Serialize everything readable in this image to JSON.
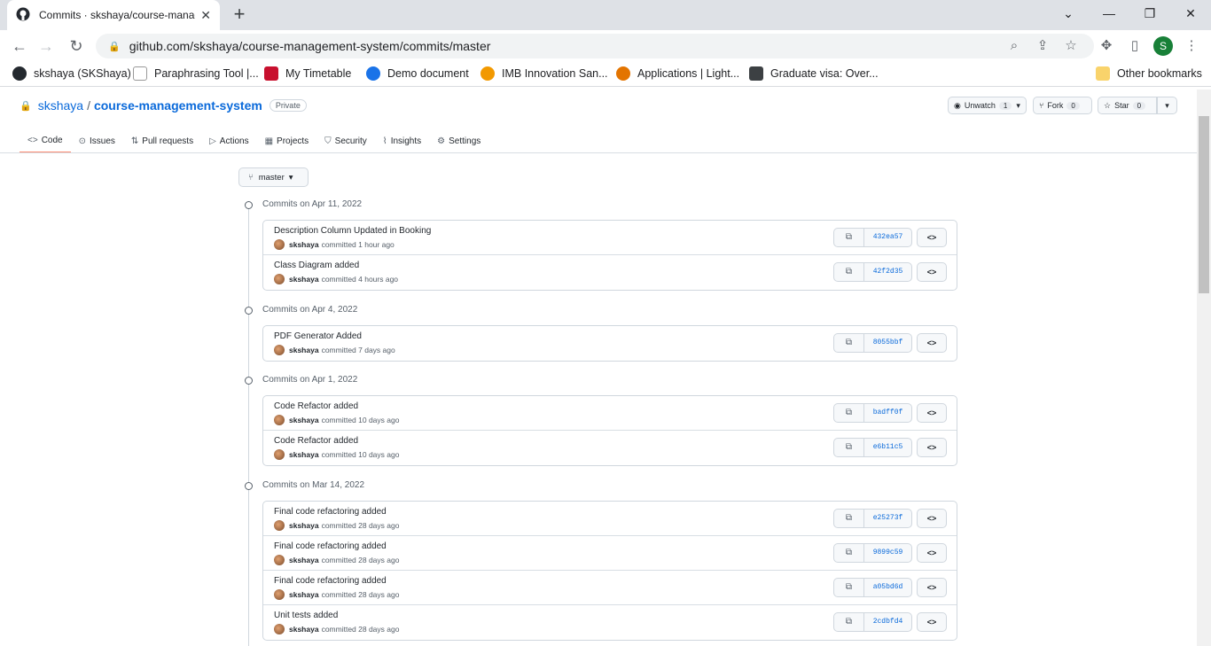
{
  "browser": {
    "tab_title": "Commits · skshaya/course-manag",
    "url": "github.com/skshaya/course-management-system/commits/master",
    "profile_initial": "S",
    "bookmarks": [
      "skshaya (SKShaya)",
      "Paraphrasing Tool |...",
      "My Timetable",
      "Demo document",
      "IMB Innovation San...",
      "Applications | Light...",
      "Graduate visa: Over..."
    ],
    "other_bookmarks": "Other bookmarks"
  },
  "repo": {
    "owner": "skshaya",
    "separator": "/",
    "name": "course-management-system",
    "visibility": "Private",
    "watch_label": "Unwatch",
    "watch_count": "1",
    "fork_label": "Fork",
    "fork_count": "0",
    "star_label": "Star",
    "star_count": "0"
  },
  "nav": {
    "tabs": [
      {
        "label": "Code",
        "icon": "<>"
      },
      {
        "label": "Issues",
        "icon": "⊙"
      },
      {
        "label": "Pull requests",
        "icon": "⇅"
      },
      {
        "label": "Actions",
        "icon": "▷"
      },
      {
        "label": "Projects",
        "icon": "▦"
      },
      {
        "label": "Security",
        "icon": "⛉"
      },
      {
        "label": "Insights",
        "icon": "⌇"
      },
      {
        "label": "Settings",
        "icon": "⚙"
      }
    ]
  },
  "branch": "master",
  "groups": [
    {
      "title": "Commits on Apr 11, 2022",
      "commits": [
        {
          "message": "Description Column Updated in Booking",
          "author": "skshaya",
          "when": "committed 1 hour ago",
          "sha": "432ea57"
        },
        {
          "message": "Class Diagram added",
          "author": "skshaya",
          "when": "committed 4 hours ago",
          "sha": "42f2d35"
        }
      ]
    },
    {
      "title": "Commits on Apr 4, 2022",
      "commits": [
        {
          "message": "PDF Generator Added",
          "author": "skshaya",
          "when": "committed 7 days ago",
          "sha": "8055bbf"
        }
      ]
    },
    {
      "title": "Commits on Apr 1, 2022",
      "commits": [
        {
          "message": "Code Refactor added",
          "author": "skshaya",
          "when": "committed 10 days ago",
          "sha": "badff0f"
        },
        {
          "message": "Code Refactor added",
          "author": "skshaya",
          "when": "committed 10 days ago",
          "sha": "e6b11c5"
        }
      ]
    },
    {
      "title": "Commits on Mar 14, 2022",
      "commits": [
        {
          "message": "Final code refactoring added",
          "author": "skshaya",
          "when": "committed 28 days ago",
          "sha": "e25273f"
        },
        {
          "message": "Final code refactoring added",
          "author": "skshaya",
          "when": "committed 28 days ago",
          "sha": "9899c59"
        },
        {
          "message": "Final code refactoring added",
          "author": "skshaya",
          "when": "committed 28 days ago",
          "sha": "a05bd6d"
        },
        {
          "message": "Unit tests added",
          "author": "skshaya",
          "when": "committed 28 days ago",
          "sha": "2cdbfd4"
        }
      ]
    }
  ]
}
